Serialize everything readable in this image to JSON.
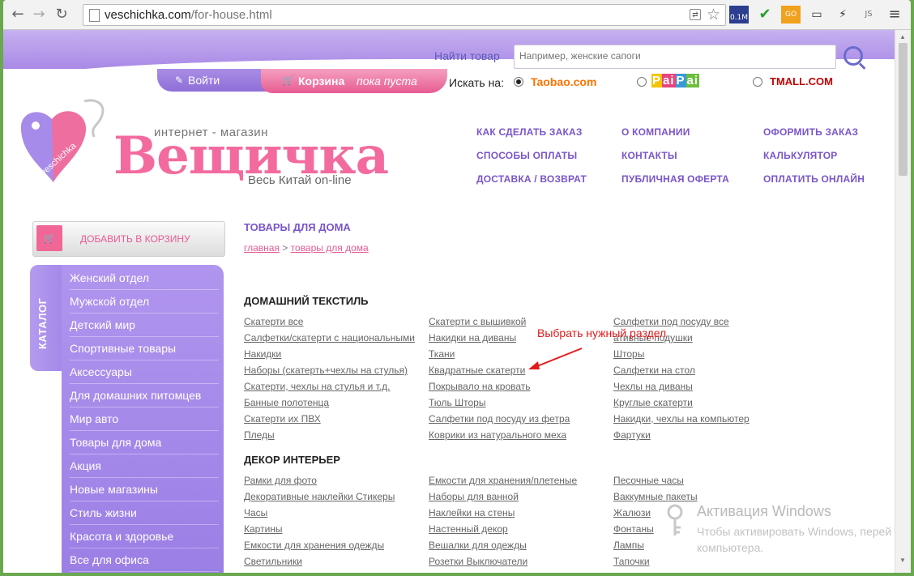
{
  "browser": {
    "url_domain": "veschichka.com",
    "url_path": "/for-house.html",
    "extensions": [
      "0.1M",
      "✔",
      "GO",
      "▭",
      "⚡",
      "JS",
      "≡"
    ]
  },
  "header": {
    "search_label": "Найти товар",
    "search_placeholder": "Например, женские сапоги",
    "login_label": "Войти",
    "cart_label": "Корзина",
    "cart_state": "пока пуста",
    "search_on_label": "Искать на:",
    "sources": [
      "Taobao.com",
      "PaiPai",
      "TMALL.COM"
    ],
    "selected_source": "Taobao.com"
  },
  "logo": {
    "tag_text": "veschichka",
    "subtitle": "интернет - магазин",
    "name": "Вещичка",
    "tagline": "Весь Китай on-line"
  },
  "topnav": [
    "КАК СДЕЛАТЬ ЗАКАЗ",
    "О КОМПАНИИ",
    "ОФОРМИТЬ ЗАКАЗ",
    "СПОСОБЫ ОПЛАТЫ",
    "КОНТАКТЫ",
    "КАЛЬКУЛЯТОР",
    "ДОСТАВКА / ВОЗВРАТ",
    "ПУБЛИЧНАЯ ОФЕРТА",
    "ОПЛАТИТЬ ОНЛАЙН"
  ],
  "sidebar": {
    "add_to_cart": "ДОБАВИТЬ В КОРЗИНУ",
    "catalog_label": "КАТАЛОГ",
    "items": [
      "Женский отдел",
      "Мужской отдел",
      "Детский мир",
      "Спортивные товары",
      "Аксессуары",
      "Для домашних питомцев",
      "Мир авто",
      "Товары для дома",
      "Акция",
      "Новые магазины",
      "Стиль жизни",
      "Красота и здоровье",
      "Все для офиса"
    ]
  },
  "content": {
    "title": "ТОВАРЫ ДЛЯ ДОМА",
    "breadcrumb_home": "главная",
    "breadcrumb_sep": " > ",
    "breadcrumb_current": "товары для дома",
    "sections": [
      {
        "title": "ДОМАШНИЙ ТЕКСТИЛЬ",
        "col1": [
          "Скатерти все",
          "Салфетки/скатерти с национальными",
          "Накидки",
          "Наборы (скатерть+чехлы на стулья)",
          "Скатерти, чехлы на стулья и т.д.",
          "Банные полотенца",
          "Скатерти их ПВХ",
          "Пледы"
        ],
        "col2": [
          "Скатерти с вышивкой",
          "Накидки на диваны",
          "Ткани",
          "Квадратные скатерти",
          "Покрывало на кровать",
          "Тюль Шторы",
          "Салфетки под посуду из фетра",
          "Коврики из натурального меха"
        ],
        "col3": [
          "Салфетки под посуду все",
          "ативные подушки",
          "Шторы",
          "Салфетки на стол",
          "Чехлы на диваны",
          "Круглые скатерти",
          "Накидки, чехлы на компьютер",
          "Фартуки"
        ]
      },
      {
        "title": "ДЕКОР ИНТЕРЬЕР",
        "col1": [
          "Рамки для фото",
          "Декоративные наклейки Стикеры",
          "Часы",
          "Картины",
          "Емкости для хранения одежды",
          "Светильники"
        ],
        "col2": [
          "Емкости для хранения/плетеные",
          "Наборы для ванной",
          "Наклейки на стены",
          "Настенный декор",
          "Вешалки для одежды",
          "Розетки Выключатели"
        ],
        "col3": [
          "Песочные часы",
          "Ваккумные пакеты",
          "Жалюзи",
          "Фонтаны",
          "Лампы",
          "Тапочки"
        ]
      }
    ],
    "annotation": "Выбрать нужный раздел"
  },
  "watermark": {
    "title": "Активация Windows",
    "line1": "Чтобы активировать Windows, перей",
    "line2": "компьютера."
  }
}
